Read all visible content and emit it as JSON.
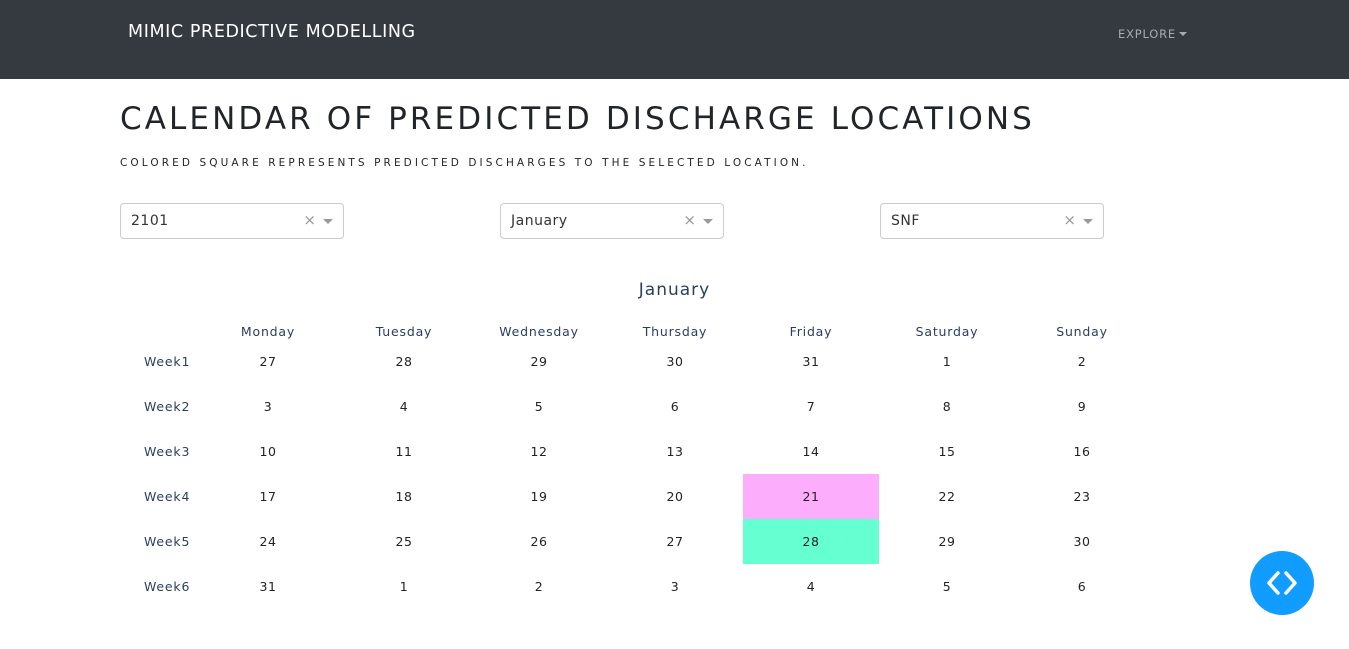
{
  "navbar": {
    "brand": "MIMIC PREDICTIVE MODELLING",
    "explore_label": "EXPLORE"
  },
  "header": {
    "title": "CALENDAR OF PREDICTED DISCHARGE LOCATIONS",
    "subtitle": "COLORED SQUARE REPRESENTS PREDICTED DISCHARGES TO THE SELECTED LOCATION."
  },
  "filters": {
    "year": "2101",
    "month": "January",
    "location": "SNF"
  },
  "calendar": {
    "title": "January",
    "days": [
      "Monday",
      "Tuesday",
      "Wednesday",
      "Thursday",
      "Friday",
      "Saturday",
      "Sunday"
    ],
    "weeks": [
      {
        "label": "Week1",
        "dates": [
          "27",
          "28",
          "29",
          "30",
          "31",
          "1",
          "2"
        ]
      },
      {
        "label": "Week2",
        "dates": [
          "3",
          "4",
          "5",
          "6",
          "7",
          "8",
          "9"
        ]
      },
      {
        "label": "Week3",
        "dates": [
          "10",
          "11",
          "12",
          "13",
          "14",
          "15",
          "16"
        ]
      },
      {
        "label": "Week4",
        "dates": [
          "17",
          "18",
          "19",
          "20",
          "21",
          "22",
          "23"
        ]
      },
      {
        "label": "Week5",
        "dates": [
          "24",
          "25",
          "26",
          "27",
          "28",
          "29",
          "30"
        ]
      },
      {
        "label": "Week6",
        "dates": [
          "31",
          "1",
          "2",
          "3",
          "4",
          "5",
          "6"
        ]
      }
    ],
    "highlights": [
      {
        "week": 3,
        "day": 4,
        "color": "#fcaefc"
      },
      {
        "week": 4,
        "day": 4,
        "color": "#66ffd2"
      }
    ]
  },
  "debug_button": {
    "icon": "code-brackets-icon",
    "color": "#119dff"
  }
}
